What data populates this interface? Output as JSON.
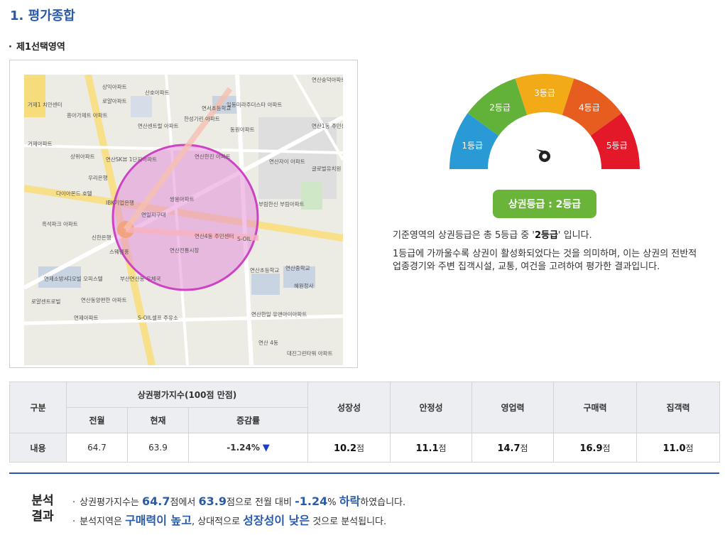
{
  "page_title": "1. 평가종합",
  "section_title": "제1선택영역",
  "bullet": "·",
  "map": {
    "labels": [
      "상익아파트",
      "로얄아파트",
      "거제1 치안센터",
      "흥아가제트 아파트",
      "거제아파트",
      "산호아파트",
      "연서초등학교",
      "일동미라주더스타 아파트",
      "연산1동 주민센터",
      "동원아파트",
      "연산센트럴 아파트",
      "한성기린 아파트",
      "상위아파트",
      "연산SK뷰 1단지아파트",
      "우리은행",
      "다이아몬드 호텔",
      "IBK기업은행",
      "연일지구대",
      "쌍용아파트",
      "연산4동 주민센터",
      "연산전통시장",
      "흑석파크 아파트",
      "신한은행",
      "스웨덴홍",
      "S-OIL",
      "부림한신",
      "연산초등학교",
      "연산중학교",
      "혜원정사",
      "연제소방서",
      "디오빌 오피스텔",
      "부산연산동 우체국",
      "연산동양편한 아파트",
      "로얄센트로빌",
      "연제아파트",
      "S-OIL셀프 주유소",
      "연산한일 유앤아이아파트",
      "대진그린타워 아파트",
      "연산 4동",
      "글로벌유치원",
      "부림아파트",
      "연산자이 아파트",
      "연산숭덕아파트",
      "연산한진 아파트"
    ]
  },
  "gauge": {
    "grades": [
      {
        "label": "1등급",
        "color": "#2a9ad6"
      },
      {
        "label": "2등급",
        "color": "#62b23a"
      },
      {
        "label": "3등급",
        "color": "#f2aa17"
      },
      {
        "label": "4등급",
        "color": "#e75d1f"
      },
      {
        "label": "5등급",
        "color": "#e3192a"
      }
    ],
    "current_grade": 2
  },
  "grade_badge": "상권등급 : 2등급",
  "description": {
    "line1_pre": "기준영역의 상권등급은 총 5등급 중 '",
    "line1_bold": "2등급",
    "line1_post": "' 입니다.",
    "line2": "1등급에 가까울수록 상권이 활성화되었다는 것을 의미하며, 이는 상권의 전반적 업종경기와 주변 집객시설, 교통, 여건을 고려하여 평가한 결과입니다."
  },
  "table": {
    "headers": {
      "category": "구분",
      "index_group": "상권평가지수(100점 만점)",
      "prev_month": "전월",
      "current": "현재",
      "change_rate": "증감률",
      "growth": "성장성",
      "stability": "안정성",
      "business": "영업력",
      "purchasing": "구매력",
      "attraction": "집객력"
    },
    "row": {
      "label": "내용",
      "prev_month": "64.7",
      "current": "63.9",
      "change_rate": "-1.24%",
      "change_arrow": "▼",
      "growth": "10.2",
      "stability": "11.1",
      "business": "14.7",
      "purchasing": "16.9",
      "attraction": "11.0",
      "unit": "점"
    }
  },
  "analysis": {
    "label_line1": "분석",
    "label_line2": "결과",
    "line1": {
      "t1": "상권평가지수는 ",
      "v1": "64.7",
      "t2": "점에서 ",
      "v2": "63.9",
      "t3": "점으로 전월 대비 ",
      "v3": "-1.24",
      "t4": "% ",
      "v4": "하락",
      "t5": "하였습니다."
    },
    "line2": {
      "t1": "분석지역은 ",
      "v1": "구매력이 높고",
      "t2": ", 상대적으로 ",
      "v2": "성장성이 낮은",
      "t3": " 것으로 분석됩니다."
    }
  }
}
